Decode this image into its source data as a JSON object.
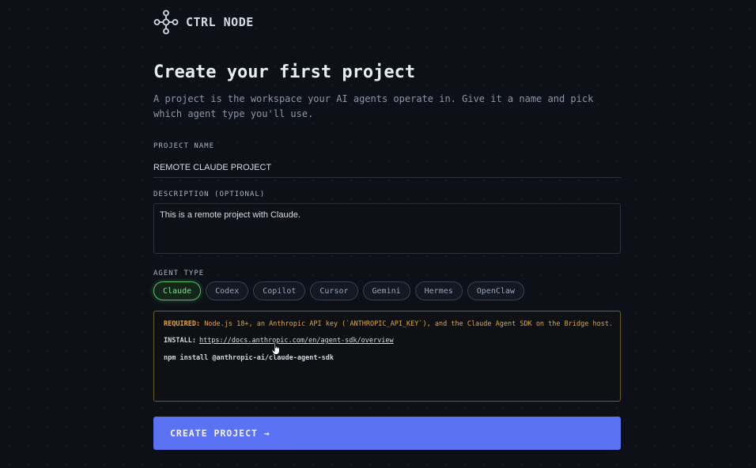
{
  "brand": {
    "name": "CTRL NODE",
    "logo_icon": "node-graph-icon"
  },
  "header": {
    "title": "Create your first project",
    "subtitle": "A project is the workspace your AI agents operate in. Give it a name and pick which agent type you'll use."
  },
  "form": {
    "project_name": {
      "label": "PROJECT NAME",
      "value": "REMOTE CLAUDE PROJECT"
    },
    "description": {
      "label": "DESCRIPTION (OPTIONAL)",
      "value": "This is a remote project with Claude."
    },
    "agent_type": {
      "label": "AGENT TYPE",
      "options": [
        "Claude",
        "Codex",
        "Copilot",
        "Cursor",
        "Gemini",
        "Hermes",
        "OpenClaw"
      ],
      "selected": "Claude"
    }
  },
  "requirements": {
    "required_label": "REQUIRED:",
    "required_text": "Node.js 18+, an Anthropic API key (`ANTHROPIC_API_KEY`), and the Claude Agent SDK on the Bridge host.",
    "install_label": "INSTALL:",
    "install_link": "https://docs.anthropic.com/en/agent-sdk/overview",
    "command": "npm install @anthropic-ai/claude-agent-sdk"
  },
  "actions": {
    "create_label": "CREATE PROJECT →"
  },
  "colors": {
    "accent": "#5b72f5",
    "selected": "#4fbf5f",
    "warning": "#e3a33c",
    "background": "#0d1117"
  }
}
